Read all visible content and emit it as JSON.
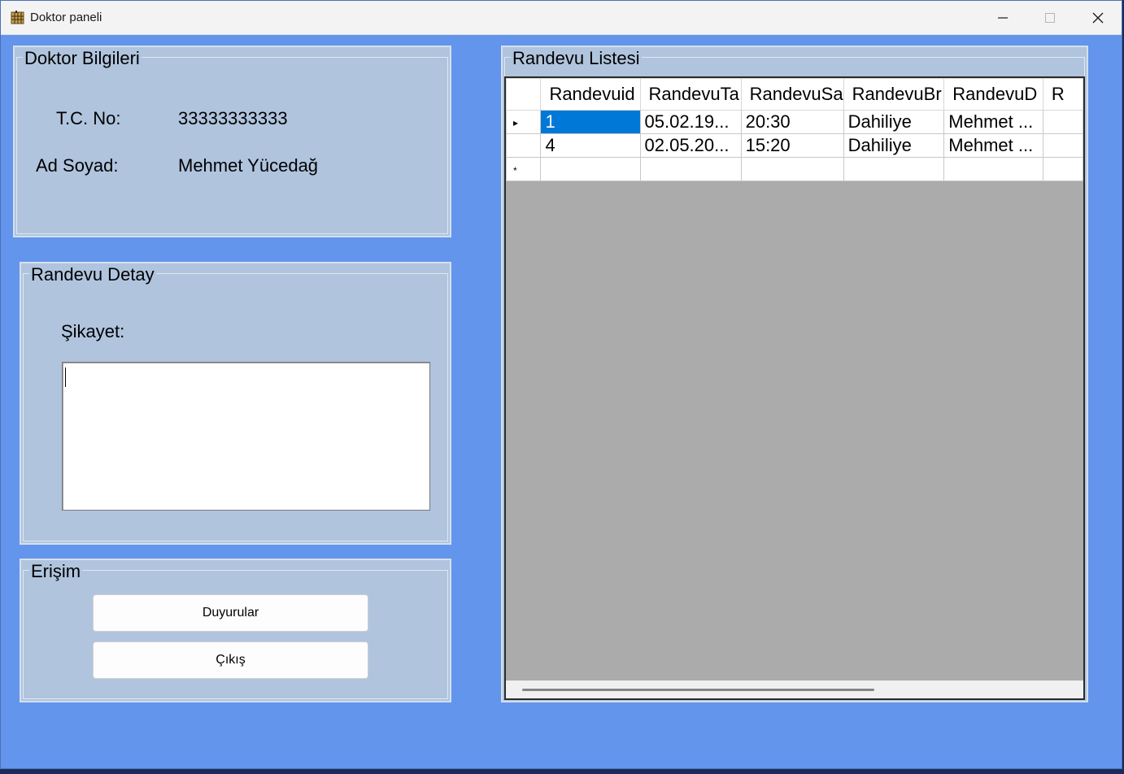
{
  "window": {
    "title": "Doktor paneli",
    "icon": "app-grid-icon"
  },
  "doctor_info": {
    "legend": "Doktor Bilgileri",
    "tc_label": "T.C. No:",
    "tc_value": "33333333333",
    "name_label": "Ad Soyad:",
    "name_value": "Mehmet Yücedağ"
  },
  "appointment_detail": {
    "legend": "Randevu Detay",
    "complaint_label": "Şikayet:",
    "complaint_value": ""
  },
  "access": {
    "legend": "Erişim",
    "announcements_label": "Duyurular",
    "exit_label": "Çıkış"
  },
  "appointment_list": {
    "legend": "Randevu Listesi",
    "columns": [
      "Randevuid",
      "RandevuTa",
      "RandevuSa",
      "RandevuBr",
      "RandevuD",
      "R"
    ],
    "rows": [
      [
        "1",
        "05.02.19...",
        "20:30",
        "Dahiliye",
        "Mehmet ...",
        ""
      ],
      [
        "4",
        "02.05.20...",
        "15:20",
        "Dahiliye",
        "Mehmet ...",
        ""
      ],
      [
        "",
        "",
        "",
        "",
        "",
        ""
      ]
    ],
    "current_row_glyph": "▸",
    "new_row_glyph": "*"
  },
  "colors": {
    "form_bg": "#6495ed",
    "panel_bg": "#b0c4de",
    "selection": "#0078d7",
    "grid_bg": "#ababab"
  }
}
